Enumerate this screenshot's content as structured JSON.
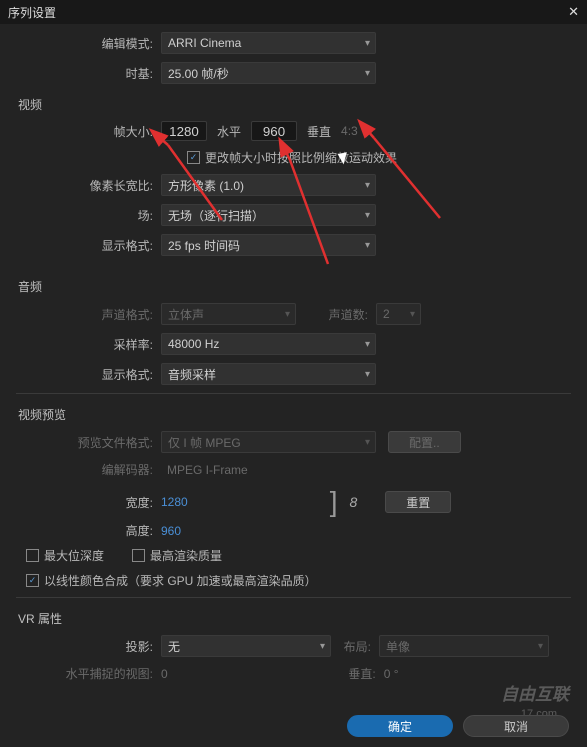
{
  "title": "序列设置",
  "general": {
    "edit_mode_label": "编辑模式:",
    "edit_mode_value": "ARRI Cinema",
    "timebase_label": "时基:",
    "timebase_value": "25.00 帧/秒"
  },
  "video": {
    "section": "视频",
    "frame_size_label": "帧大小:",
    "width": "1280",
    "width_label": "水平",
    "height": "960",
    "height_label": "垂直",
    "aspect": "4:3",
    "scale_checkbox": "更改帧大小时按照比例缩放运动效果",
    "pixel_ratio_label": "像素长宽比:",
    "pixel_ratio_value": "方形像素 (1.0)",
    "field_label": "场:",
    "field_value": "无场（逐行扫描）",
    "display_label": "显示格式:",
    "display_value": "25 fps 时间码"
  },
  "audio": {
    "section": "音频",
    "channel_fmt_label": "声道格式:",
    "channel_fmt_value": "立体声",
    "channel_count_label": "声道数:",
    "channel_count_value": "2",
    "sample_rate_label": "采样率:",
    "sample_rate_value": "48000 Hz",
    "display_label": "显示格式:",
    "display_value": "音频采样"
  },
  "preview": {
    "section": "视频预览",
    "file_fmt_label": "预览文件格式:",
    "file_fmt_value": "仅 I 帧 MPEG",
    "config_btn": "配置..",
    "codec_label": "编解码器:",
    "codec_value": "MPEG I-Frame",
    "width_label": "宽度:",
    "width_value": "1280",
    "height_label": "高度:",
    "height_value": "960",
    "link_icon": "8",
    "reset_btn": "重置",
    "max_depth": "最大位深度",
    "max_quality": "最高渲染质量",
    "linear_color": "以线性颜色合成（要求 GPU 加速或最高渲染品质）"
  },
  "vr": {
    "section": "VR 属性",
    "projection_label": "投影:",
    "projection_value": "无",
    "layout_label": "布局:",
    "layout_value": "单像",
    "hfov_label": "水平捕捉的视图:",
    "hfov_value": "0",
    "vfov_label": "垂直:",
    "vfov_value": "0 °"
  },
  "buttons": {
    "ok": "确定",
    "cancel": "取消"
  },
  "watermark": {
    "line1": "自由互联",
    "line2": "17.com"
  },
  "chart_data": null
}
